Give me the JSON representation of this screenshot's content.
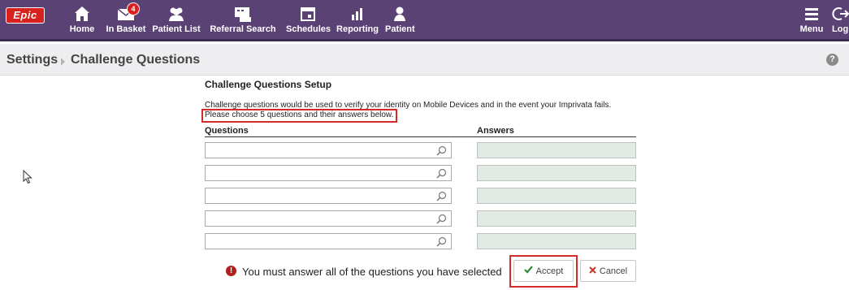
{
  "app": {
    "logo_text": "Epic"
  },
  "nav": {
    "items": [
      {
        "label": "Home",
        "icon": "home-icon"
      },
      {
        "label": "In Basket",
        "icon": "envelope-icon",
        "badge": "4"
      },
      {
        "label": "Patient List",
        "icon": "patients-icon"
      },
      {
        "label": "Referral Search",
        "icon": "referral-icon"
      },
      {
        "label": "Schedules",
        "icon": "calendar-icon"
      },
      {
        "label": "Reporting",
        "icon": "bar-chart-icon"
      },
      {
        "label": "Patient",
        "icon": "person-icon"
      }
    ],
    "menu_label": "Menu",
    "logout_label": "Log O"
  },
  "breadcrumb": {
    "root": "Settings",
    "current": "Challenge Questions"
  },
  "setup": {
    "title": "Challenge Questions Setup",
    "description": "Challenge questions would be used to verify your identity on Mobile Devices and in the event your Imprivata fails.",
    "instruction": "Please choose 5 questions and their answers below.",
    "questions_header": "Questions",
    "answers_header": "Answers",
    "rows": [
      {
        "question": "",
        "answer": ""
      },
      {
        "question": "",
        "answer": ""
      },
      {
        "question": "",
        "answer": ""
      },
      {
        "question": "",
        "answer": ""
      },
      {
        "question": "",
        "answer": ""
      }
    ]
  },
  "error": {
    "message": "You must answer all of the questions you have selected"
  },
  "buttons": {
    "accept": "Accept",
    "cancel": "Cancel"
  },
  "colors": {
    "topbar": "#5a4275",
    "highlight": "#d42a2a",
    "accept_check": "#2e8b3a",
    "cancel_x": "#c0392b",
    "error": "#b01f1f"
  }
}
